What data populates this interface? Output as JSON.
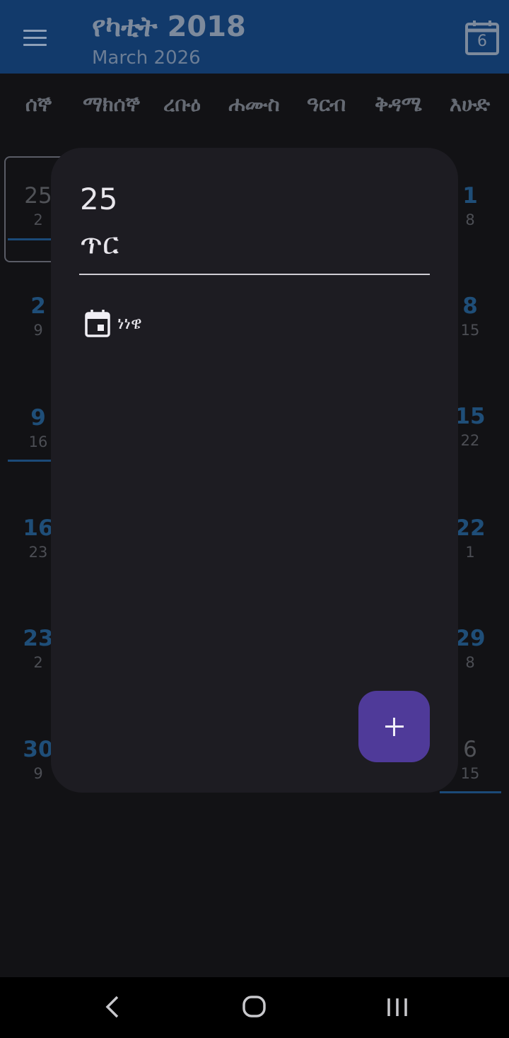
{
  "header": {
    "title": "የካቲት 2018",
    "subtitle": "March 2026",
    "today_badge": "6",
    "menu_icon": "hamburger-menu-icon",
    "calendar_icon": "calendar-today-icon"
  },
  "weekdays": [
    "ሰኞ",
    "ማክሰኞ",
    "ረቡዕ",
    "ሐሙስ",
    "ዓርብ",
    "ቅዳሜ",
    "እሁድ"
  ],
  "calendar": {
    "left_column": [
      {
        "ethiopic": "25",
        "gregorian": "2"
      },
      {
        "ethiopic": "2",
        "gregorian": "9"
      },
      {
        "ethiopic": "9",
        "gregorian": "16"
      },
      {
        "ethiopic": "16",
        "gregorian": "23"
      },
      {
        "ethiopic": "23",
        "gregorian": "2"
      },
      {
        "ethiopic": "30",
        "gregorian": "9"
      }
    ],
    "right_column": [
      {
        "ethiopic": "1",
        "gregorian": "8"
      },
      {
        "ethiopic": "8",
        "gregorian": "15"
      },
      {
        "ethiopic": "15",
        "gregorian": "22"
      },
      {
        "ethiopic": "22",
        "gregorian": "1"
      },
      {
        "ethiopic": "29",
        "gregorian": "8"
      },
      {
        "ethiopic": "6",
        "gregorian": "15"
      }
    ]
  },
  "dialog": {
    "day": "25",
    "month": "ጥር",
    "events": [
      {
        "label": "ነነዌ",
        "icon": "event-calendar-icon"
      }
    ],
    "fab_icon": "plus-icon"
  },
  "colors": {
    "appbar": "#123a6b",
    "background": "#121215",
    "dialog": "#1d1c22",
    "fab": "#4f3a99",
    "date_accent": "#1f4e78"
  }
}
